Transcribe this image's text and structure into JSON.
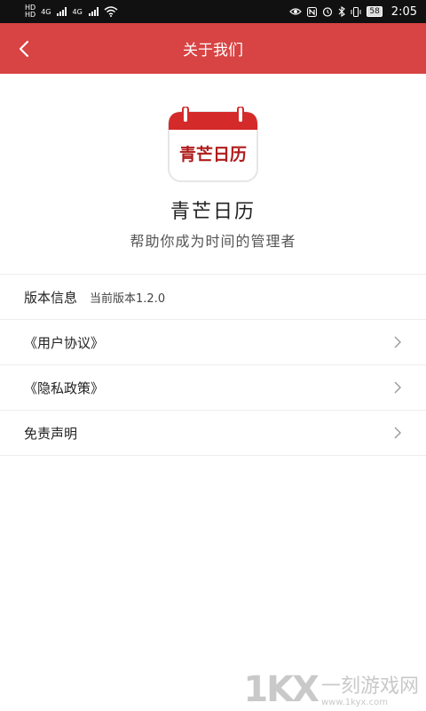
{
  "status_bar": {
    "hd_top": "HD",
    "hd_bottom": "HD",
    "sig1": "4G",
    "sig2": "4G",
    "battery": "58",
    "time": "2:05"
  },
  "header": {
    "title": "关于我们",
    "back_icon": "chevron-left-icon"
  },
  "hero": {
    "icon_text": "青芒日历",
    "app_name": "青芒日历",
    "tagline": "帮助你成为时间的管理者"
  },
  "list": {
    "version_label": "版本信息",
    "version_value": "当前版本1.2.0",
    "user_agreement": "《用户协议》",
    "privacy_policy": "《隐私政策》",
    "disclaimer": "免责声明"
  },
  "watermark": {
    "logo": "1KX",
    "cn": "一刻游戏网",
    "url": "www.1kyx.com"
  },
  "colors": {
    "primary": "#d84343",
    "divider": "#eeeeee"
  }
}
